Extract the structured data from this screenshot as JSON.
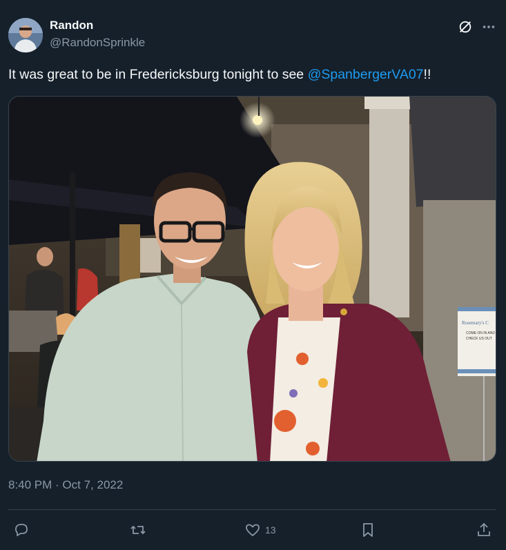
{
  "author": {
    "display_name": "Randon",
    "handle": "@RandonSprinkle"
  },
  "tweet": {
    "text_prefix": "It was great to be in Fredericksburg tonight to see ",
    "mention": "@SpanbergerVA07",
    "text_suffix": "!!",
    "timestamp": "8:40 PM · Oct 7, 2022"
  },
  "photo": {
    "sign_lines": [
      "Rosemary's C",
      "COME ON IN AND",
      "CHECK US OUT"
    ]
  },
  "actions": {
    "likes_count": "13"
  },
  "icons": {
    "reply": "reply-icon",
    "retweet": "retweet-icon",
    "like": "heart-icon",
    "bookmark": "bookmark-icon",
    "share": "share-icon",
    "grok": "grok-icon",
    "more": "more-icon"
  },
  "colors": {
    "background": "#15202b",
    "accent": "#1d9bf0",
    "secondary_text": "#8b98a5"
  }
}
